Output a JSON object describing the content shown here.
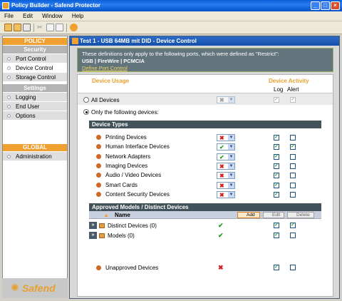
{
  "window": {
    "title": "Policy Builder - Safend Protector"
  },
  "menu": [
    "File",
    "Edit",
    "Window",
    "Help"
  ],
  "sidebar": {
    "policy_header": "POLICY",
    "security_header": "Security",
    "security_items": [
      "Port Control",
      "Device Control",
      "Storage Control"
    ],
    "settings_header": "Settings",
    "settings_items": [
      "Logging",
      "End User Messages",
      "Options"
    ],
    "global_header": "GLOBAL",
    "global_items": [
      "Administration"
    ],
    "selected": "Device Control",
    "logo": "Safend"
  },
  "main": {
    "title": "Test 1 - USB 64MB mit DID - Device Control",
    "info_line": "These definitions only apply to the following ports, which were defined as \"Restrict\":",
    "ports": "USB  |  FireWire  |  PCMCIA",
    "define_link": "Define Port Control",
    "device_usage_header": "Device Usage",
    "device_activity_header": "Device Activity",
    "log_label": "Log",
    "alert_label": "Alert",
    "all_devices_label": "All Devices",
    "only_following_label": "Only the following devices:",
    "device_types_header": "Device Types",
    "device_types": [
      {
        "name": "Printing Devices",
        "state": "block",
        "log": true,
        "alert": false
      },
      {
        "name": "Human Interface Devices",
        "state": "allow",
        "log": true,
        "alert": true
      },
      {
        "name": "Network Adapters",
        "state": "allow",
        "log": true,
        "alert": false
      },
      {
        "name": "Imaging Devices",
        "state": "block",
        "log": true,
        "alert": false
      },
      {
        "name": "Audio / Video Devices",
        "state": "block",
        "log": true,
        "alert": false
      },
      {
        "name": "Smart Cards",
        "state": "block",
        "log": true,
        "alert": false
      },
      {
        "name": "Content Security Devices",
        "state": "block",
        "log": true,
        "alert": false
      }
    ],
    "approved_header": "Approved Models / Distinct Devices",
    "name_column": "Name",
    "add_label": "Add",
    "edit_label": "Edit",
    "delete_label": "Delete",
    "approved_rows": [
      {
        "name": "Distinct Devices (0)",
        "state": "allow",
        "log": true,
        "alert": true
      },
      {
        "name": "Models (0)",
        "state": "allow",
        "log": true,
        "alert": false
      }
    ],
    "unapproved_label": "Unapproved Devices",
    "unapproved": {
      "state": "block",
      "log": true,
      "alert": false
    }
  },
  "colors": {
    "accent": "#f0a030",
    "header_bar": "#42525a",
    "title_blue": "#2c6ac8"
  }
}
